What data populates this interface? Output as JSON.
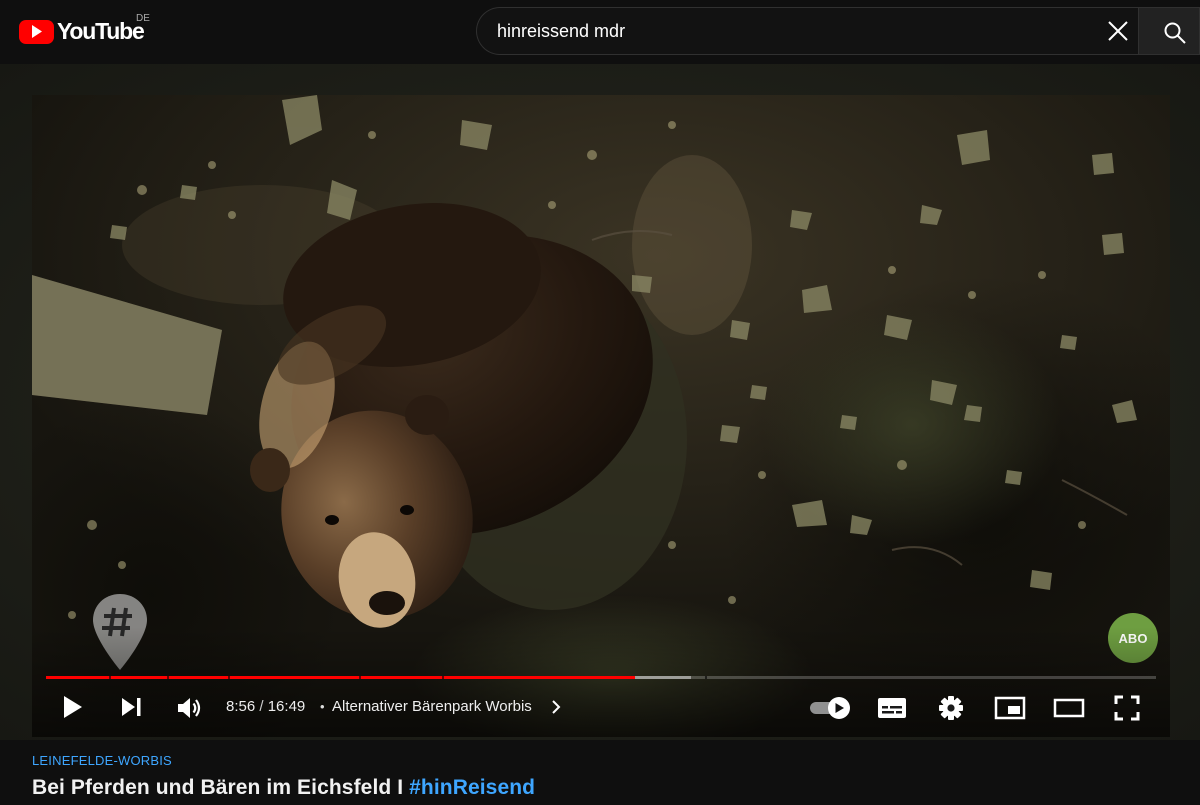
{
  "header": {
    "logo_text": "YouTube",
    "country_code": "DE",
    "search_value": "hinreissend mdr",
    "clear_icon": "close-icon",
    "search_icon": "search-icon",
    "brand_color": "#ff0000"
  },
  "player": {
    "current_time": "8:56",
    "duration": "16:49",
    "time_separator": "/",
    "chapter_separator": "•",
    "chapter_title": "Alternativer Bärenpark Worbis",
    "played_fraction": 0.531,
    "buffered_fraction": 0.581,
    "chapter_markers": [
      0.057,
      0.109,
      0.164,
      0.282,
      0.357,
      0.594
    ],
    "progress_color": "#ff0000",
    "subscribe_badge": "ABO",
    "autoplay_on": true,
    "icons": [
      "play-icon",
      "next-icon",
      "volume-icon",
      "autoplay-toggle-icon",
      "subtitles-icon",
      "settings-gear-icon",
      "miniplayer-icon",
      "theater-mode-icon",
      "fullscreen-icon",
      "hashtag-pin-icon"
    ]
  },
  "video": {
    "location": "LEINEFELDE-WORBIS",
    "title_text": "Bei Pferden und Bären im Eichsfeld I ",
    "title_hashtag": "#hinReisend",
    "link_color": "#3ea6ff"
  }
}
